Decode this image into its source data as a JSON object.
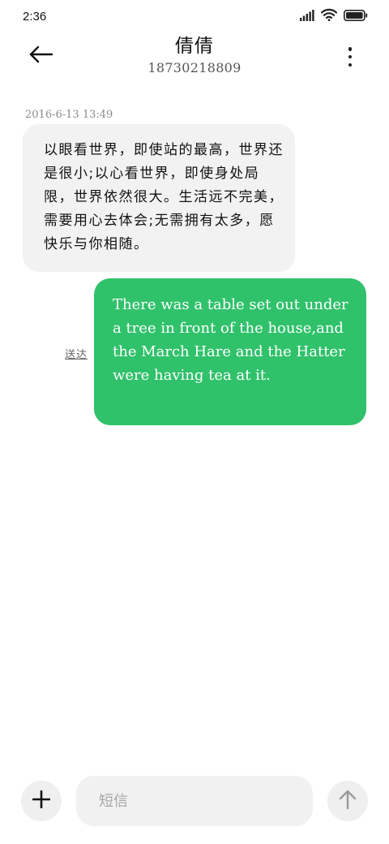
{
  "status_bar": {
    "time": "2:36",
    "icons": [
      "signal-icon",
      "wifi-icon",
      "battery-icon"
    ]
  },
  "header": {
    "contact_name": "倩倩",
    "contact_number": "18730218809",
    "back_icon": "arrow-left-icon",
    "more_icon": "more-vertical-icon"
  },
  "conversation": {
    "timestamp": "2016-6-13 13:49",
    "messages": [
      {
        "direction": "incoming",
        "text": "以眼看世界，即使站的最高，世界还是很小;以心看世界，即使身处局限，世界依然很大。生活远不完美，需要用心去体会;无需拥有太多，愿快乐与你相随。"
      },
      {
        "direction": "outgoing",
        "text": "There was a table set out under a tree in front of the house,and the March Hare and the Hatter were having tea at it.",
        "status": "送达"
      }
    ]
  },
  "composer": {
    "add_icon": "plus-icon",
    "placeholder": "短信",
    "value": "",
    "send_icon": "arrow-up-icon"
  },
  "colors": {
    "outgoing_bubble": "#30c16b",
    "incoming_bubble": "#f2f2f2",
    "background": "#ffffff"
  }
}
